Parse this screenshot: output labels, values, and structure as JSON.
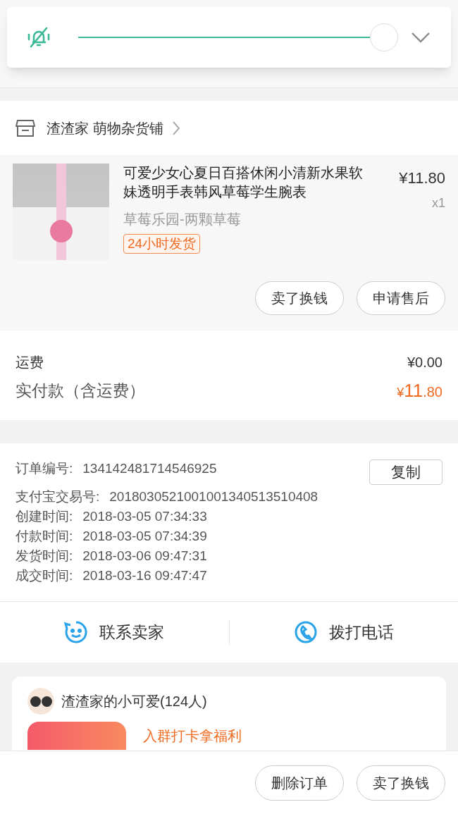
{
  "volume_popup": {
    "muted": true,
    "level": 1
  },
  "shop": {
    "name": "渣渣家 萌物杂货铺"
  },
  "item": {
    "title": "可爱少女心夏日百搭休闲小清新水果软妹透明手表韩风草莓学生腕表",
    "price": "¥11.80",
    "quantity": "x1",
    "variant": "草莓乐园-两颗草莓",
    "tag": "24小时发货",
    "buttons": [
      "卖了换钱",
      "申请售后"
    ]
  },
  "fees": [
    {
      "label": "运费",
      "value": "¥0.00",
      "kind": "plain"
    },
    {
      "label": "实付款（含运费）",
      "currency": "¥",
      "integer": "11",
      "decimal": ".80",
      "kind": "total"
    }
  ],
  "order_info": [
    {
      "label": "订单编号:",
      "value": "134142481714546925"
    },
    {
      "label": "支付宝交易号:",
      "value": "2018030521001001340513510408"
    },
    {
      "label": "创建时间:",
      "value": "2018-03-05 07:34:33"
    },
    {
      "label": "付款时间:",
      "value": "2018-03-05 07:34:39"
    },
    {
      "label": "发货时间:",
      "value": "2018-03-06 09:47:31"
    },
    {
      "label": "成交时间:",
      "value": "2018-03-16 09:47:47"
    }
  ],
  "copy_button": "复制",
  "contact": [
    {
      "label": "联系卖家",
      "kind": "chat"
    },
    {
      "label": "拨打电话",
      "kind": "phone"
    }
  ],
  "group": {
    "name": "渣渣家的小可爱(124人)",
    "promo": "入群打卡拿福利"
  },
  "bottom_buttons": [
    "删除订单",
    "卖了换钱"
  ]
}
